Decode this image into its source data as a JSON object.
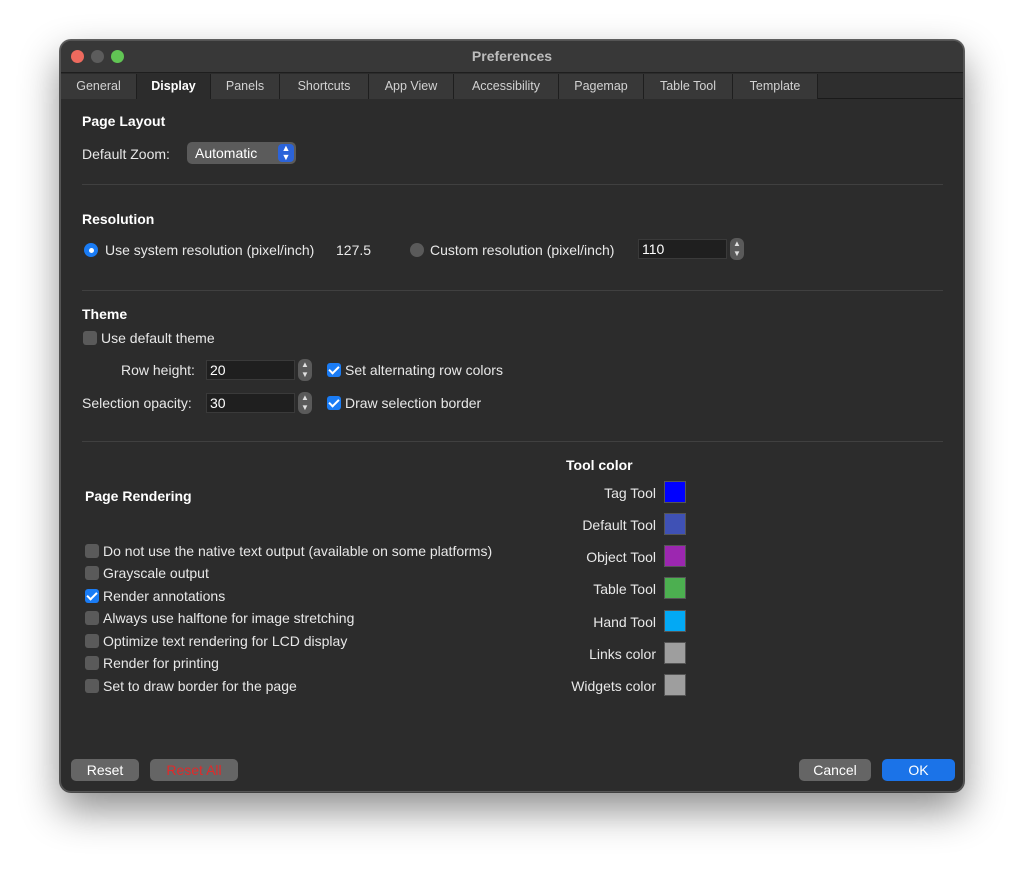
{
  "window": {
    "title": "Preferences"
  },
  "tabs": [
    {
      "label": "General"
    },
    {
      "label": "Display"
    },
    {
      "label": "Panels"
    },
    {
      "label": "Shortcuts"
    },
    {
      "label": "App View"
    },
    {
      "label": "Accessibility"
    },
    {
      "label": "Pagemap"
    },
    {
      "label": "Table Tool"
    },
    {
      "label": "Template"
    }
  ],
  "active_tab": "Display",
  "page_layout": {
    "title": "Page Layout",
    "zoom_label": "Default Zoom:",
    "zoom_value": "Automatic"
  },
  "resolution": {
    "title": "Resolution",
    "system_label": "Use system resolution (pixel/inch)",
    "system_value": "127.5",
    "system_selected": true,
    "custom_label": "Custom resolution (pixel/inch)",
    "custom_value": "110"
  },
  "theme": {
    "title": "Theme",
    "use_default_label": "Use default theme",
    "use_default_checked": false,
    "row_height_label": "Row height:",
    "row_height_value": "20",
    "alternating_label": "Set alternating row colors",
    "alternating_checked": true,
    "selection_opacity_label": "Selection opacity:",
    "selection_opacity_value": "30",
    "selection_border_label": "Draw selection border",
    "selection_border_checked": true
  },
  "page_rendering": {
    "title": "Page Rendering",
    "options": [
      {
        "label": "Do not use the native text output (available on some platforms)",
        "checked": false
      },
      {
        "label": "Grayscale output",
        "checked": false
      },
      {
        "label": "Render annotations",
        "checked": true
      },
      {
        "label": "Always use halftone for image stretching",
        "checked": false
      },
      {
        "label": "Optimize text rendering for LCD display",
        "checked": false
      },
      {
        "label": "Render for printing",
        "checked": false
      },
      {
        "label": "Set to draw border for the page",
        "checked": false
      }
    ]
  },
  "tool_color": {
    "title": "Tool color",
    "items": [
      {
        "label": "Tag Tool",
        "color": "#0000ff"
      },
      {
        "label": "Default Tool",
        "color": "#3f51b5"
      },
      {
        "label": "Object Tool",
        "color": "#9c27b0"
      },
      {
        "label": "Table Tool",
        "color": "#4caf50"
      },
      {
        "label": "Hand Tool",
        "color": "#03a9f4"
      },
      {
        "label": "Links color",
        "color": "#9e9e9e"
      },
      {
        "label": "Widgets color",
        "color": "#9e9e9e"
      }
    ]
  },
  "footer": {
    "reset_label": "Reset",
    "reset_all_label": "Reset All",
    "cancel_label": "Cancel",
    "ok_label": "OK"
  }
}
